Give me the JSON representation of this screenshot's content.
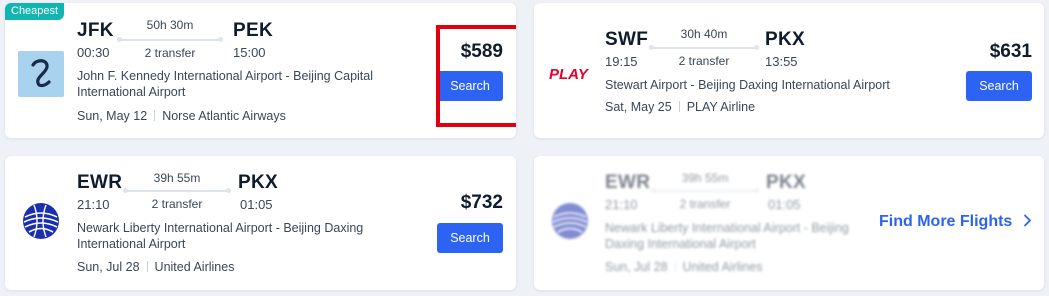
{
  "cards": [
    {
      "badge": "Cheapest",
      "from_code": "JFK",
      "from_time": "00:30",
      "to_code": "PEK",
      "to_time": "15:00",
      "duration": "50h 30m",
      "transfer": "2 transfer",
      "airports": "John F. Kennedy International Airport - Beijing Capital International Airport",
      "date": "Sun, May 12",
      "airline": "Norse Atlantic Airways",
      "price": "$589",
      "button": "Search",
      "logo_icon": "norse-atlantic-logo-icon"
    },
    {
      "from_code": "SWF",
      "from_time": "19:15",
      "to_code": "PKX",
      "to_time": "13:55",
      "duration": "30h 40m",
      "transfer": "2 transfer",
      "airports": "Stewart Airport - Beijing Daxing International Airport",
      "date": "Sat, May 25",
      "airline": "PLAY Airline",
      "price": "$631",
      "button": "Search",
      "logo_icon": "play-airline-logo-icon",
      "logo_text": "PLAY"
    },
    {
      "from_code": "EWR",
      "from_time": "21:10",
      "to_code": "PKX",
      "to_time": "01:05",
      "duration": "39h 55m",
      "transfer": "2 transfer",
      "airports": "Newark Liberty International Airport - Beijing Daxing International Airport",
      "date": "Sun, Jul 28",
      "airline": "United Airlines",
      "price": "$732",
      "button": "Search",
      "logo_icon": "united-airlines-logo-icon"
    },
    {
      "from_code": "EWR",
      "from_time": "21:10",
      "to_code": "PKX",
      "to_time": "01:05",
      "duration": "39h 55m",
      "transfer": "2 transfer",
      "airports": "Newark Liberty International Airport - Beijing Daxing International Airport",
      "date": "Sun, Jul 28",
      "airline": "United Airlines",
      "find_more": "Find More Flights",
      "find_more_icon": "chevron-right-icon",
      "logo_icon": "united-airlines-logo-icon"
    }
  ],
  "colors": {
    "accent": "#2c63f2",
    "badge": "#13b5b1",
    "highlight": "#e00010",
    "play_red": "#e4002b",
    "united_blue": "#1a2fb0"
  }
}
